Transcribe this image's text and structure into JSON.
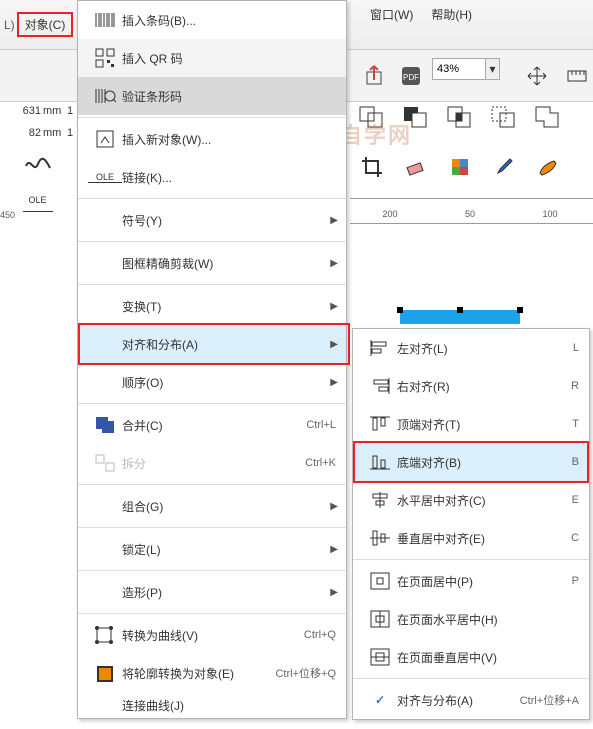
{
  "menubar": {
    "object": "对象(C)",
    "window": "窗口(W)",
    "help": "帮助(H)"
  },
  "toolbar": {
    "zoom_value": "43%"
  },
  "dims": {
    "w_val": "631",
    "w_unit": "mm",
    "w_spin": "1",
    "h_val": "82",
    "h_unit": "mm",
    "h_spin": "1"
  },
  "ruler": {
    "t200": "200",
    "t450": "450",
    "t50": "50",
    "t100": "100"
  },
  "watermark": "软件自学网",
  "menu1": {
    "insert_barcode": "插入条码(B)...",
    "insert_qr": "插入 QR 码",
    "validate_barcode": "验证条形码",
    "insert_object": "插入新对象(W)...",
    "links": "链接(K)...",
    "symbol": "符号(Y)",
    "powerclip": "图框精确剪裁(W)",
    "transform": "变换(T)",
    "align_distribute": "对齐和分布(A)",
    "order": "顺序(O)",
    "combine": "合并(C)",
    "combine_sc": "Ctrl+L",
    "break": "拆分",
    "break_sc": "Ctrl+K",
    "group": "组合(G)",
    "lock": "锁定(L)",
    "shaping": "造形(P)",
    "to_curves": "转换为曲线(V)",
    "to_curves_sc": "Ctrl+Q",
    "outline_obj": "将轮廓转换为对象(E)",
    "outline_obj_sc": "Ctrl+位移+Q",
    "join_curves": "连接曲线(J)"
  },
  "menu2": {
    "align_left": "左对齐(L)",
    "al_sc": "L",
    "align_right": "右对齐(R)",
    "ar_sc": "R",
    "align_top": "顶端对齐(T)",
    "at_sc": "T",
    "align_bottom": "底端对齐(B)",
    "ab_sc": "B",
    "center_h": "水平居中对齐(C)",
    "ch_sc": "E",
    "center_v": "垂直居中对齐(E)",
    "cv_sc": "C",
    "page_center": "在页面居中(P)",
    "pc_sc": "P",
    "page_center_h": "在页面水平居中(H)",
    "page_center_v": "在页面垂直居中(V)",
    "align_dist": "对齐与分布(A)",
    "align_dist_sc": "Ctrl+位移+A"
  }
}
